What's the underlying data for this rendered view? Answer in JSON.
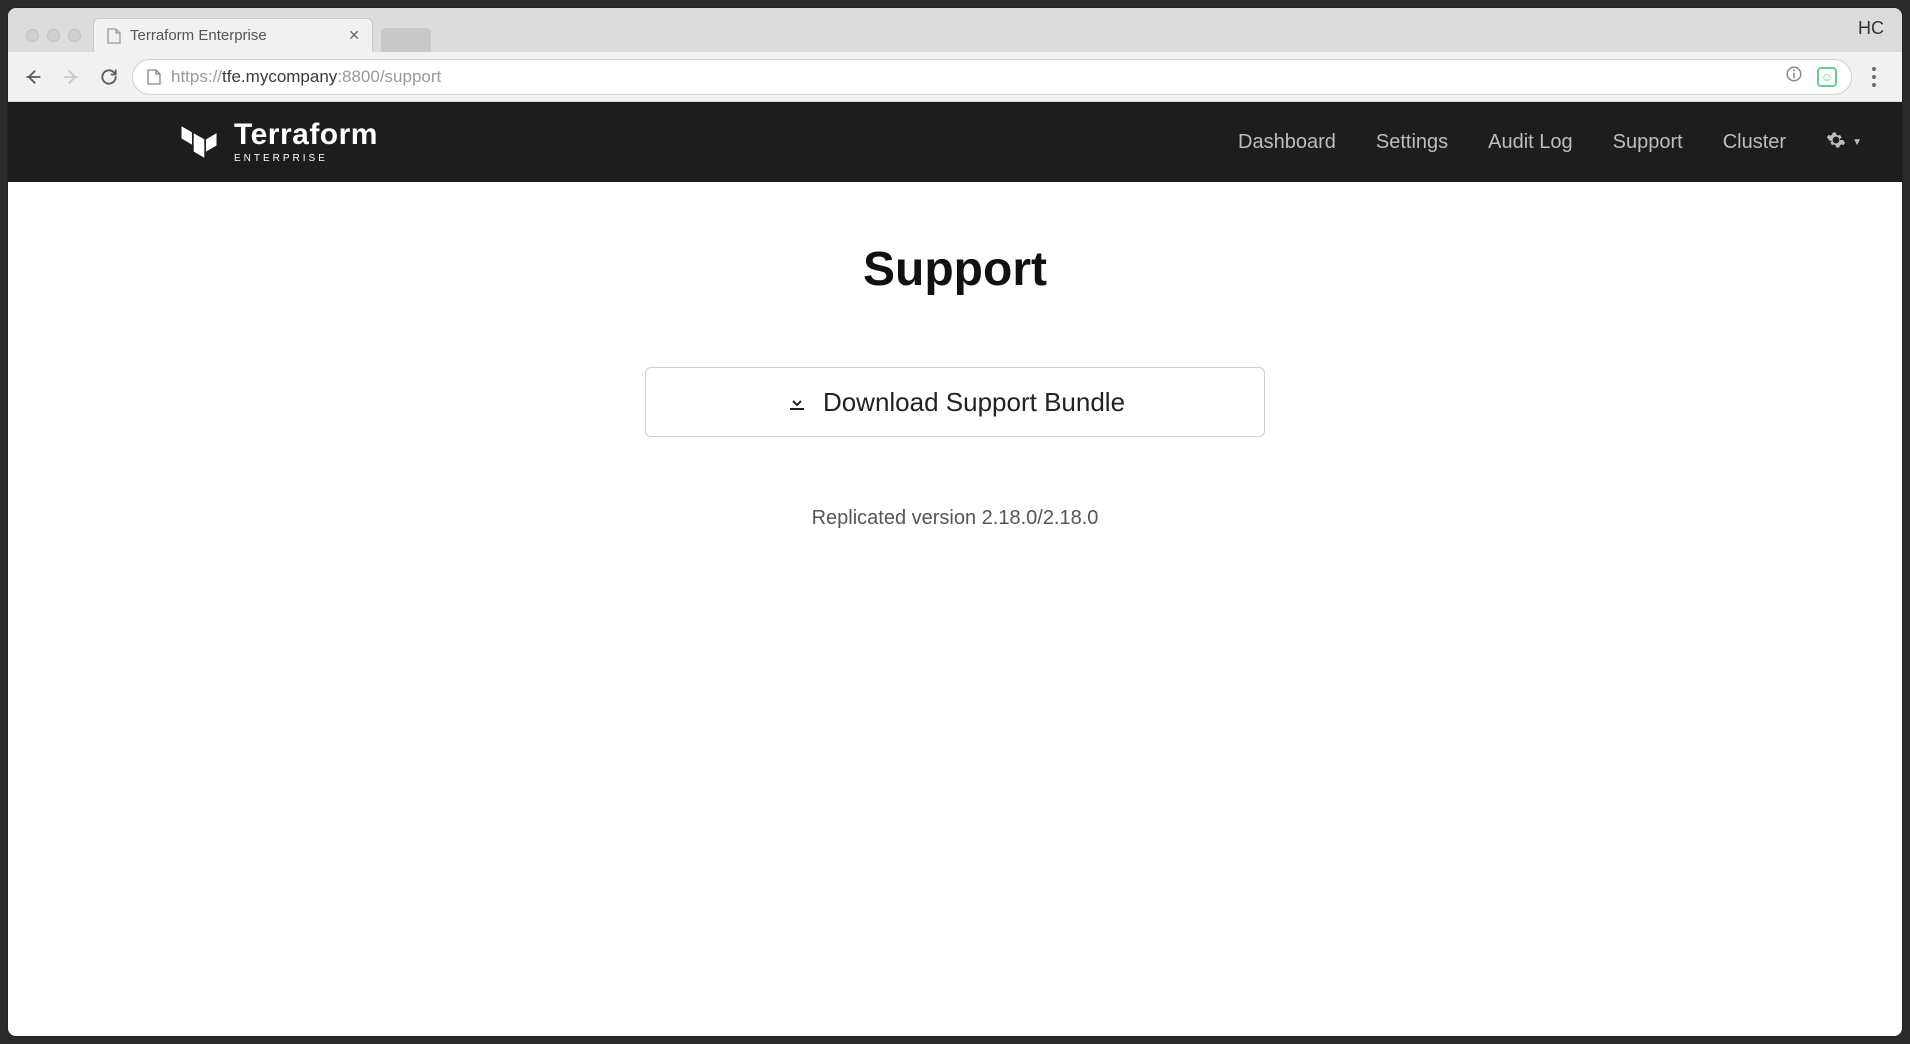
{
  "browser": {
    "tab_title": "Terraform Enterprise",
    "profile_label": "HC",
    "url": {
      "scheme": "https://",
      "host": "tfe.mycompany",
      "port_path": ":8800/support"
    }
  },
  "header": {
    "brand_main": "Terraform",
    "brand_sub": "ENTERPRISE",
    "nav": {
      "dashboard": "Dashboard",
      "settings": "Settings",
      "audit_log": "Audit Log",
      "support": "Support",
      "cluster": "Cluster"
    }
  },
  "page": {
    "title": "Support",
    "download_label": "Download Support Bundle",
    "version": "Replicated version 2.18.0/2.18.0"
  }
}
